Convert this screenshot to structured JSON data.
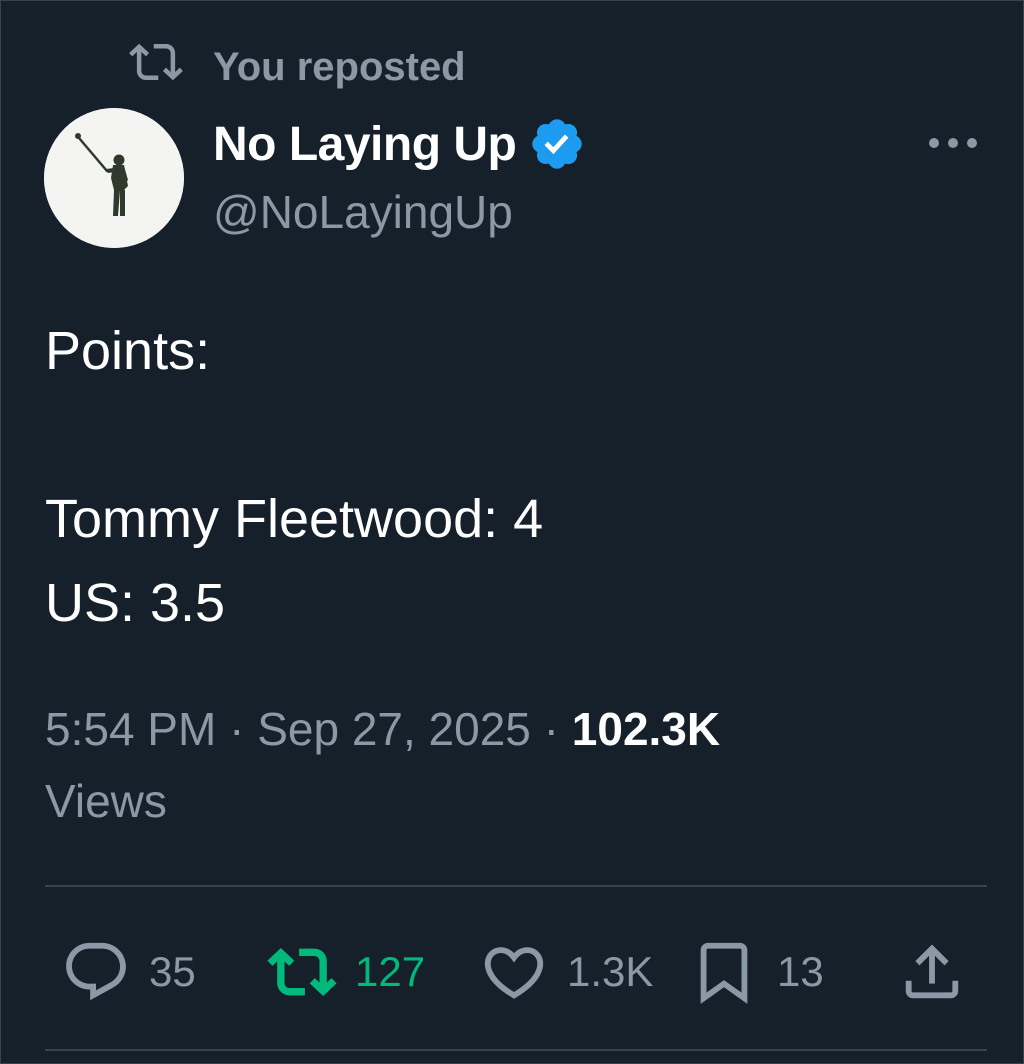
{
  "repost": {
    "label": "You reposted",
    "icon": "repost-icon"
  },
  "author": {
    "display_name": "No Laying Up",
    "handle": "@NoLayingUp",
    "verified": true,
    "verified_color": "#1d9bf0",
    "avatar_icon": "golfer-silhouette-icon"
  },
  "tweet": {
    "text": "Points:\n\nTommy Fleetwood: 4\nUS: 3.5"
  },
  "meta": {
    "time": "5:54 PM",
    "separator": "·",
    "date": "Sep 27, 2025",
    "views_count": "102.3K",
    "views_label": "Views"
  },
  "actions": {
    "replies": "35",
    "reposts": "127",
    "likes": "1.3K",
    "bookmarks": "13",
    "retweeted_color": "#00ba7c"
  },
  "colors": {
    "background": "#15202b",
    "secondary_text": "#8b98a5",
    "border": "#38444d"
  }
}
